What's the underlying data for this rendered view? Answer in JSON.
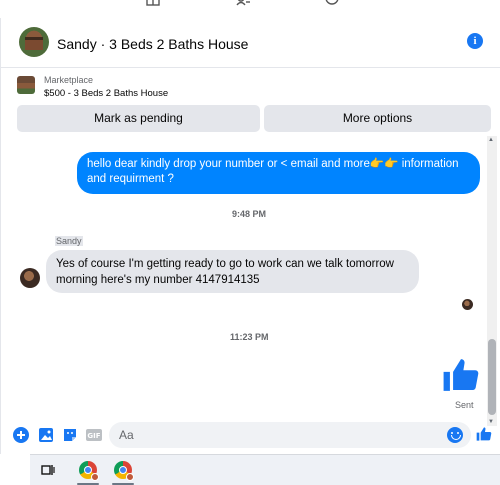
{
  "header": {
    "title": "Sandy · 3 Beds 2 Baths House"
  },
  "listing": {
    "label": "Marketplace",
    "price_title": "$500 - 3 Beds 2 Baths House",
    "mark_pending_label": "Mark as pending",
    "more_options_label": "More options"
  },
  "messages": {
    "outgoing_text": "hello dear kindly drop your number or < email and more👉👉 information and requirment ?",
    "time_1": "9:48 PM",
    "sender_name": "Sandy",
    "incoming_text": "Yes of course I'm getting ready to go to work can we talk tomorrow morning here's my number 4147914135",
    "time_2": "11:23 PM",
    "status": "Sent"
  },
  "composer": {
    "placeholder": "Aa"
  },
  "colors": {
    "accent": "#1877f2",
    "outgoing_bubble": "#0084ff",
    "incoming_bubble": "#e4e6eb"
  },
  "icons": {
    "top": [
      "grid-icon",
      "people-icon",
      "profile-icon"
    ],
    "composer": [
      "plus-circle-icon",
      "photo-icon",
      "sticker-icon",
      "gif-icon",
      "emoji-icon",
      "like-icon"
    ],
    "taskbar": [
      "task-view-icon",
      "chrome-icon",
      "chrome-icon"
    ]
  }
}
